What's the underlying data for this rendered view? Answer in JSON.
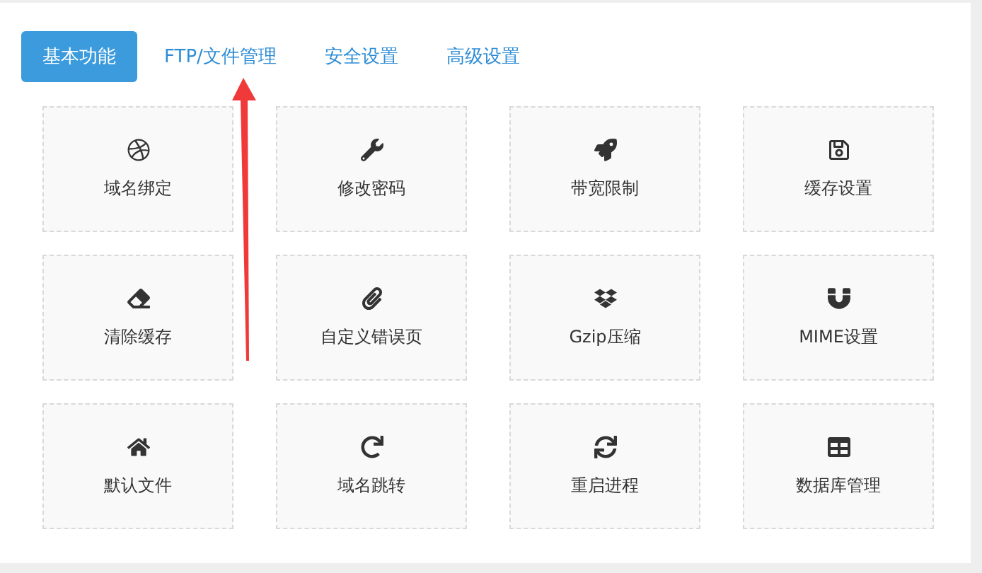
{
  "tabs": [
    {
      "label": "基本功能",
      "selected": true
    },
    {
      "label": "FTP/文件管理",
      "selected": false
    },
    {
      "label": "安全设置",
      "selected": false
    },
    {
      "label": "高级设置",
      "selected": false
    }
  ],
  "tiles": [
    {
      "label": "域名绑定"
    },
    {
      "label": "修改密码"
    },
    {
      "label": "带宽限制"
    },
    {
      "label": "缓存设置"
    },
    {
      "label": "清除缓存"
    },
    {
      "label": "自定义错误页"
    },
    {
      "label": "Gzip压缩"
    },
    {
      "label": "MIME设置"
    },
    {
      "label": "默认文件"
    },
    {
      "label": "域名跳转"
    },
    {
      "label": "重启进程"
    },
    {
      "label": "数据库管理"
    }
  ]
}
